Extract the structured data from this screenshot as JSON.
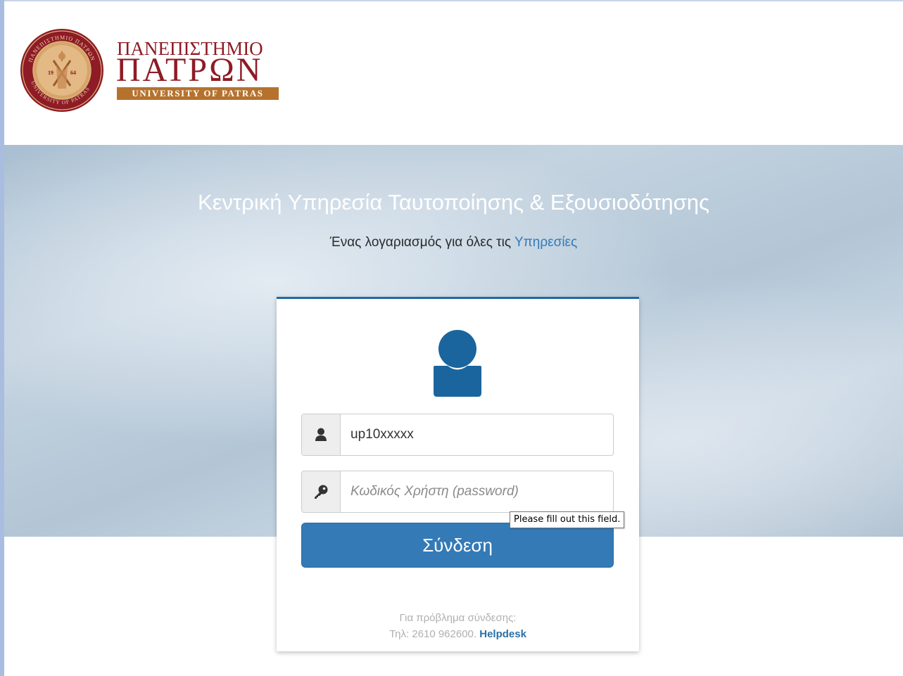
{
  "header": {
    "logo_line1": "ΠΑΝΕΠΙΣΤΗΜΙΟ",
    "logo_line2": "ΠΑΤΡΩΝ",
    "logo_line3": "UNIVERSITY OF PATRAS",
    "seal_text_top": "ΠΑΝΕΠΙΣΤΗΜΙΟ ΠΑΤΡΩΝ",
    "seal_text_bottom": "UNIVERSITY OF PATRAS",
    "seal_year_left": "19",
    "seal_year_right": "64"
  },
  "banner": {
    "title": "Κεντρική Υπηρεσία Ταυτοποίησης & Εξουσιοδότησης",
    "subtitle_prefix": "Ένας λογαριασμός για όλες τις ",
    "subtitle_link": "Υπηρεσίες"
  },
  "login": {
    "username_value": "up10xxxxx",
    "password_placeholder": "Κωδικός Χρήστη (password)",
    "tooltip": "Please fill out this field.",
    "button_label": "Σύνδεση",
    "help_line1": "Για πρόβλημα σύνδεσης:",
    "help_line2_prefix": "Τηλ: 2610 962600. ",
    "help_link": "Helpdesk"
  },
  "colors": {
    "brand_red": "#8e1b25",
    "brand_gold": "#b5722e",
    "primary_blue": "#337ab7",
    "avatar_blue": "#1a659e"
  },
  "icons": {
    "username_addon": "user-icon",
    "password_addon": "key-icon",
    "avatar": "avatar-icon"
  }
}
